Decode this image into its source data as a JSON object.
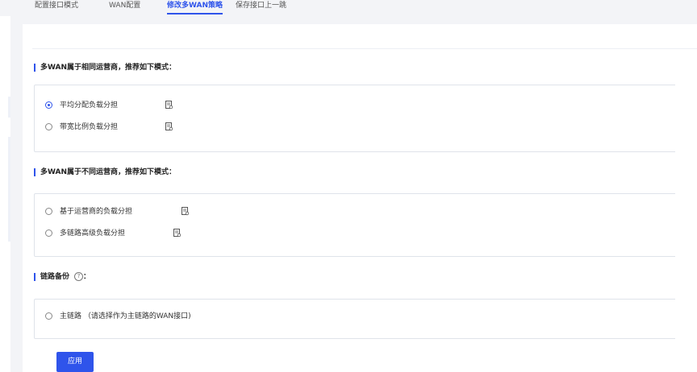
{
  "tabs": [
    {
      "label": "配置接口模式",
      "active": false
    },
    {
      "label": "WAN配置",
      "active": false
    },
    {
      "label": "修改多WAN策略",
      "active": true
    },
    {
      "label": "保存接口上一跳",
      "active": false
    }
  ],
  "sections": [
    {
      "title": "多WAN属于相同运营商，推荐如下模式：",
      "options": [
        {
          "label": "平均分配负载分担",
          "checked": true,
          "icon": "document-icon"
        },
        {
          "label": "带宽比例负载分担",
          "checked": false,
          "icon": "document-icon"
        }
      ]
    },
    {
      "title": "多WAN属于不同运营商，推荐如下模式：",
      "options": [
        {
          "label": "基于运营商的负载分担",
          "checked": false,
          "icon": "document-icon"
        },
        {
          "label": "多链路高级负载分担",
          "checked": false,
          "icon": "document-icon"
        }
      ]
    },
    {
      "title": "链路备份",
      "help_icon": "?",
      "title_suffix": "：",
      "options": [
        {
          "label": "主链路 （请选择作为主链路的WAN接口)",
          "checked": false
        }
      ]
    }
  ],
  "apply_button": {
    "label": "应用"
  },
  "colors": {
    "accent": "#2f54eb",
    "border": "#dfe3ea",
    "background": "#f3f4f7"
  }
}
